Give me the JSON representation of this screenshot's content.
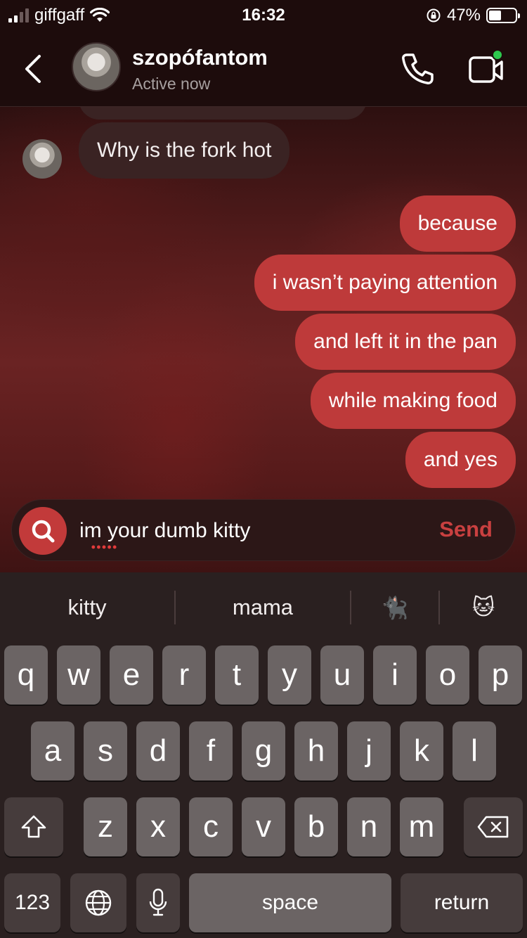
{
  "status_bar": {
    "carrier": "giffgaff",
    "time": "16:32",
    "battery_percent": "47%",
    "battery_level": 0.47
  },
  "header": {
    "contact_name": "szopófantom",
    "contact_status": "Active now",
    "icons": {
      "back": "chevron-left-icon",
      "call": "phone-icon",
      "video": "video-camera-icon"
    },
    "online_color": "#2dc84d"
  },
  "messages": [
    {
      "from": "them",
      "text": "Why is the fork hot"
    },
    {
      "from": "me",
      "text": "because"
    },
    {
      "from": "me",
      "text": "i wasn’t paying attention"
    },
    {
      "from": "me",
      "text": "and left it in the pan"
    },
    {
      "from": "me",
      "text": "while making food"
    },
    {
      "from": "me",
      "text": "and yes"
    }
  ],
  "composer": {
    "value": "im your dumb kitty",
    "send_label": "Send",
    "accent_color": "#c23a3a"
  },
  "keyboard": {
    "suggestions": [
      "kitty",
      "mama",
      "🐈‍⬛",
      "🐱"
    ],
    "row1": [
      "q",
      "w",
      "e",
      "r",
      "t",
      "y",
      "u",
      "i",
      "o",
      "p"
    ],
    "row2": [
      "a",
      "s",
      "d",
      "f",
      "g",
      "h",
      "j",
      "k",
      "l"
    ],
    "row3": [
      "z",
      "x",
      "c",
      "v",
      "b",
      "n",
      "m"
    ],
    "numbers_label": "123",
    "space_label": "space",
    "return_label": "return"
  },
  "colors": {
    "my_bubble": "#be3a3a",
    "their_bubble": "#3a2323"
  }
}
